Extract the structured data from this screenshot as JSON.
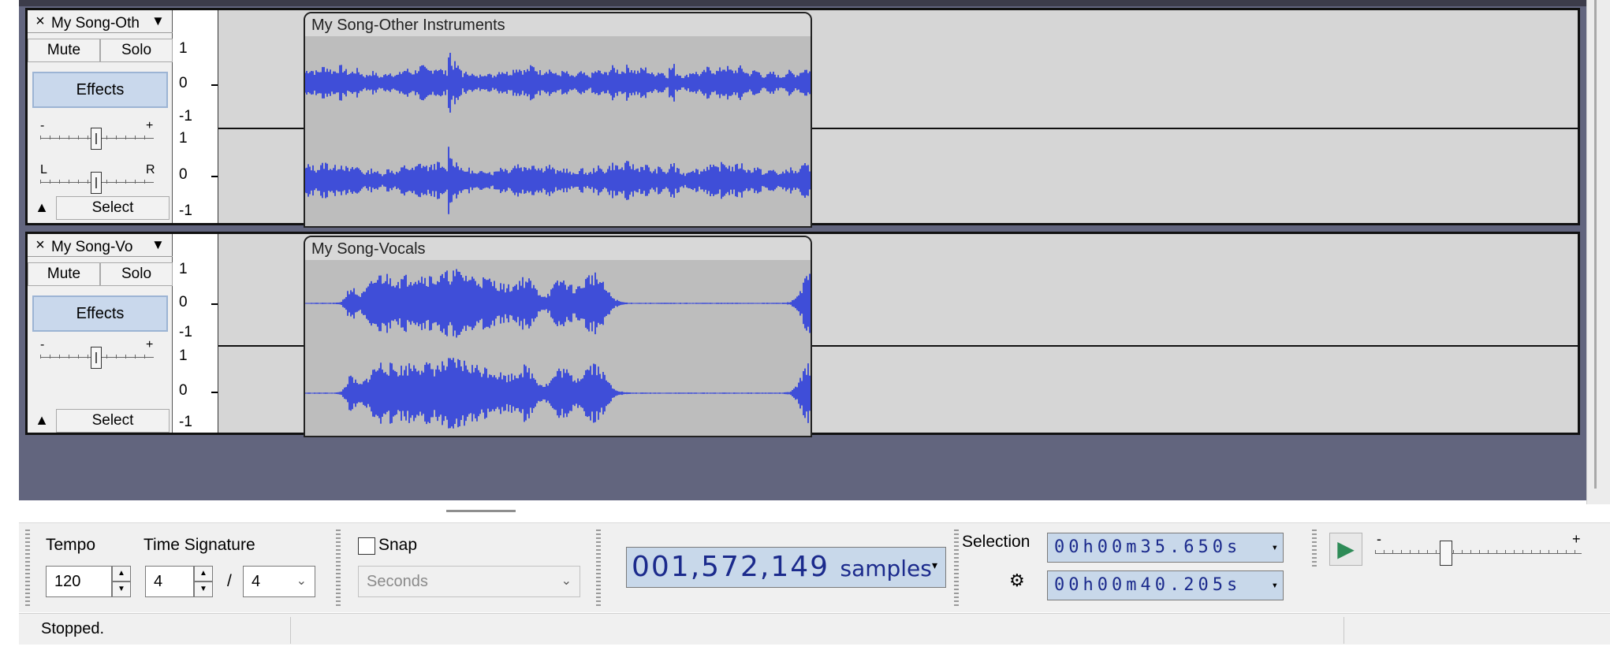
{
  "tracks": [
    {
      "name": "My Song-Oth",
      "clip_name": "My Song-Other Instruments",
      "mute_label": "Mute",
      "solo_label": "Solo",
      "effects_label": "Effects",
      "select_label": "Select",
      "gain_min": "-",
      "gain_max": "+",
      "pan_left": "L",
      "pan_right": "R",
      "scale_ch1": [
        "1",
        "0",
        "-1"
      ],
      "scale_ch2": [
        "1",
        "0",
        "-1"
      ]
    },
    {
      "name": "My Song-Vo",
      "clip_name": "My Song-Vocals",
      "mute_label": "Mute",
      "solo_label": "Solo",
      "effects_label": "Effects",
      "select_label": "Select",
      "gain_min": "-",
      "gain_max": "+",
      "scale_ch1": [
        "1",
        "0",
        "-1"
      ],
      "scale_ch2": [
        "1",
        "0",
        "-1"
      ]
    }
  ],
  "icons": {
    "close": "×",
    "menu": "▼",
    "collapse": "▲",
    "play": "▶",
    "settings": "⚙",
    "dropdown": "▾"
  },
  "colors": {
    "waveform": "#3f4ed8",
    "workspace_bg": "#62657e",
    "clip_bg": "#bdbdbd",
    "time_bg": "#c8d8ea",
    "time_text": "#1b2a8c"
  },
  "toolbar": {
    "tempo_label": "Tempo",
    "tempo_value": "120",
    "time_sig_label": "Time Signature",
    "time_sig_numerator": "4",
    "time_sig_slash": "/",
    "time_sig_denominator": "4",
    "snap_label": "Snap",
    "snap_checked": false,
    "snap_unit": "Seconds",
    "time_readout": "001,572,149",
    "time_unit": "samples",
    "selection_label": "Selection",
    "selection_start": "00h00m35.650s",
    "selection_end": "00h00m40.205s",
    "playback_min": "-",
    "playback_max": "+"
  },
  "status": {
    "text": "Stopped."
  }
}
